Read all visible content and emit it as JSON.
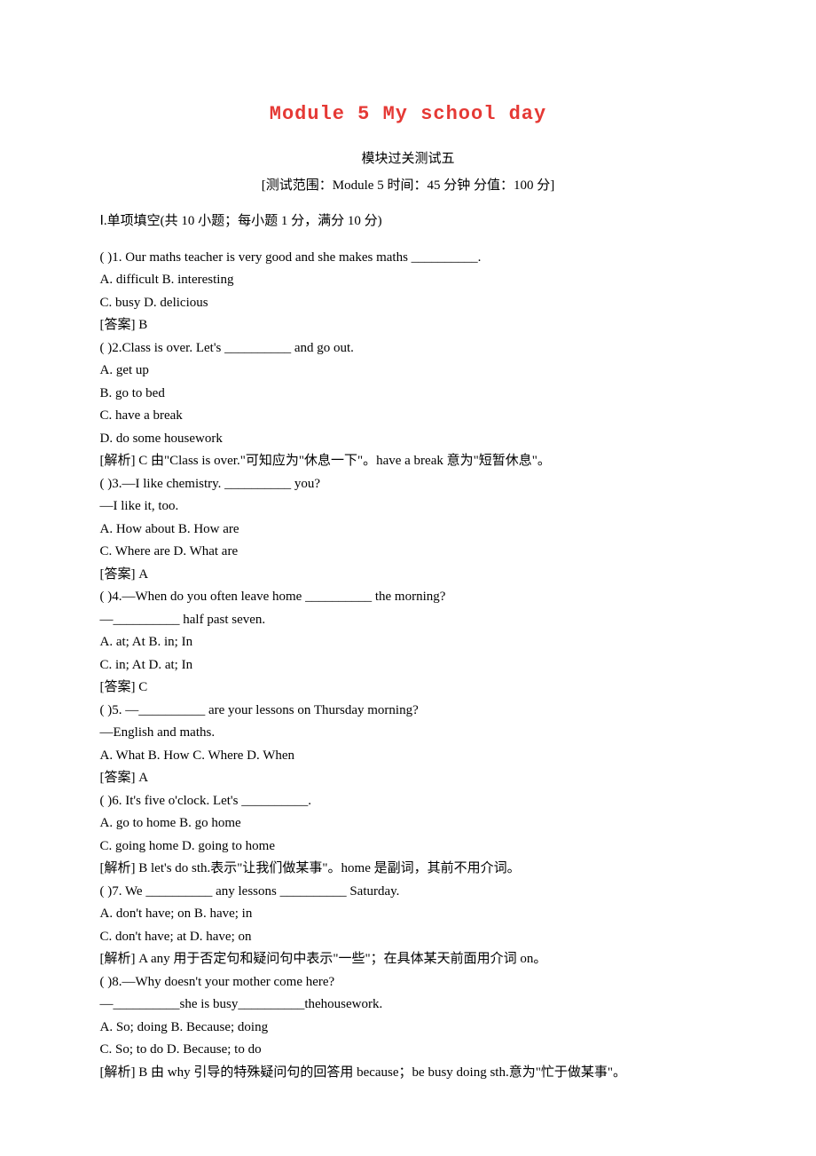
{
  "title": "Module  5   My school day",
  "subtitle": "模块过关测试五",
  "scope": "[测试范围：Module 5  时间：45 分钟  分值：100 分]",
  "section1": "Ⅰ.单项填空(共 10 小题；每小题 1 分，满分 10 分)",
  "q1": "(    )1. Our maths teacher is very good and she makes maths __________.",
  "q1a": "A. difficult  B. interesting",
  "q1b": "C. busy  D. delicious",
  "q1ans": "[答案] B",
  "q2": "(    )2.Class is over. Let's __________ and go out.",
  "q2a": "A. get up",
  "q2b": "B. go to bed",
  "q2c": "C. have a break",
  "q2d": "D. do some housework",
  "q2ans": "[解析] C  由\"Class is over.\"可知应为\"休息一下\"。have a break 意为\"短暂休息\"。",
  "q3": "(    )3.—I like chemistry. __________ you?",
  "q3r": "—I like it, too.",
  "q3a": "A. How about  B. How are",
  "q3b": "C. Where are  D. What are",
  "q3ans": "[答案] A",
  "q4": "(    )4.—When do you often leave home __________ the morning?",
  "q4r": "—__________ half past seven.",
  "q4a": "A. at; At  B. in; In",
  "q4b": "C. in; At  D. at; In",
  "q4ans": "[答案] C",
  "q5": "(    )5. —__________ are your lessons on Thursday morning?",
  "q5r": "—English and maths.",
  "q5a": "A. What  B. How  C. Where  D. When",
  "q5ans": "[答案] A",
  "q6": "(    )6. It's five o'clock. Let's __________.",
  "q6a": "A. go to home  B. go home",
  "q6b": "C. going home  D. going to home",
  "q6ans": "[解析] B  let's do sth.表示\"让我们做某事\"。home 是副词，其前不用介词。",
  "q7": "(    )7. We __________ any lessons __________ Saturday.",
  "q7a": "A. don't have; on  B. have; in",
  "q7b": "C. don't have; at  D. have; on",
  "q7ans": "[解析] A  any 用于否定句和疑问句中表示\"一些\"；在具体某天前面用介词 on。",
  "q8": "(    )8.—Why doesn't your mother come here?",
  "q8r": "—__________she is busy__________thehousework.",
  "q8a": "A. So; doing  B. Because; doing",
  "q8b": "C. So; to do  D. Because; to do",
  "q8ans": "[解析] B  由 why 引导的特殊疑问句的回答用 because；be busy doing sth.意为\"忙于做某事\"。"
}
